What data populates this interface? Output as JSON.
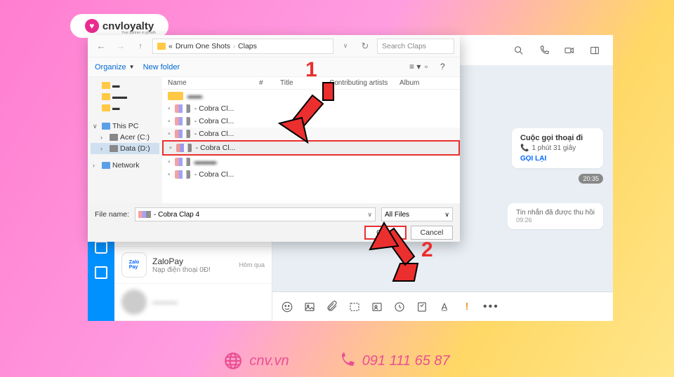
{
  "logo": {
    "brand": "cnvloyalty",
    "tagline": "Your partner in growth"
  },
  "conversations": [
    {
      "name": "",
      "sub": ""
    },
    {
      "name": "ZaloPay",
      "sub": "Nạp điện thoại 0Đ!",
      "time": "Hôm qua"
    },
    {
      "name": "",
      "sub": ""
    }
  ],
  "chat": {
    "call": {
      "title": "Cuộc gọi thoại đi",
      "duration": "1 phút 31 giây",
      "action": "GỌI LẠI"
    },
    "time_badge": "20:35",
    "recalled": {
      "text": "Tin nhắn đã được thu hồi",
      "time": "09:26"
    }
  },
  "dialog": {
    "breadcrumb": [
      "Drum One Shots",
      "Claps"
    ],
    "search_placeholder": "Search Claps",
    "organize": "Organize",
    "newfolder": "New folder",
    "cols": {
      "c1": "Name",
      "c2": "#",
      "c3": "Title",
      "c4": "Contributing artists",
      "c5": "Album"
    },
    "tree": {
      "pc": "This PC",
      "acer": "Acer (C:)",
      "data": "Data (D:)",
      "net": "Network"
    },
    "rows": [
      "- Cobra Cl...",
      "- Cobra Cl...",
      "- Cobra Cl...",
      "- Cobra Cl...",
      "",
      "- Cobra Cl..."
    ],
    "selected_row": "- Cobra Cl...",
    "filename_label": "File name:",
    "filename_val": "- Cobra Clap 4",
    "filter": "All Files",
    "open": "Open",
    "cancel": "Cancel"
  },
  "annot": {
    "n1": "1",
    "n2": "2"
  },
  "footer": {
    "site": "cnv.vn",
    "phone": "091 111 65 87"
  }
}
